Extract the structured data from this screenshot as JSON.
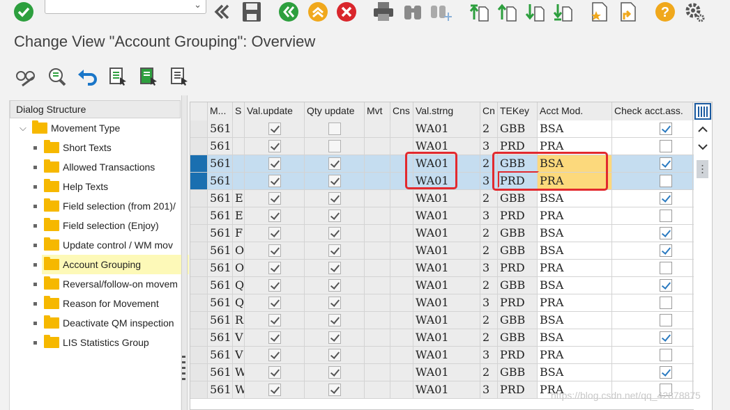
{
  "toolbar": {
    "command_field_value": "",
    "icons": [
      "enter-icon",
      "back-icon",
      "save-icon",
      "back-green-icon",
      "exit-icon",
      "cancel-icon",
      "print-icon",
      "find-icon",
      "find-next-icon",
      "first-page-icon",
      "previous-page-icon",
      "next-page-icon",
      "last-page-icon",
      "create-session-icon",
      "shortcut-icon",
      "help-icon",
      "settings-icon"
    ]
  },
  "title": "Change View \"Account Grouping\": Overview",
  "app_toolbar_icons": [
    "display-change-icon",
    "details-icon",
    "undo-icon",
    "select-all-icon",
    "select-block-icon",
    "deselect-all-icon"
  ],
  "dialog_structure": {
    "header": "Dialog Structure",
    "root": "Movement Type",
    "items": [
      "Short Texts",
      "Allowed Transactions",
      "Help Texts",
      "Field selection (from 201)/",
      "Field selection (Enjoy)",
      "Update control / WM mov",
      "Account Grouping",
      "Reversal/follow-on movem",
      "Reason for Movement",
      "Deactivate QM inspection",
      "LIS Statistics Group"
    ],
    "selected_index": 6
  },
  "table": {
    "columns": [
      "M...",
      "S",
      "Val.update",
      "Qty update",
      "Mvt",
      "Cns",
      "Val.strng",
      "Cn",
      "TEKey",
      "Acct Mod.",
      "Check acct.ass."
    ],
    "rows": [
      {
        "m": "561",
        "s": "",
        "val_update": true,
        "qty_update": false,
        "mvt": "",
        "cns": "",
        "val_strng": "WA01",
        "cn": "2",
        "tekey": "GBB",
        "acct_mod": "BSA",
        "check": true,
        "selected": false
      },
      {
        "m": "561",
        "s": "",
        "val_update": true,
        "qty_update": false,
        "mvt": "",
        "cns": "",
        "val_strng": "WA01",
        "cn": "3",
        "tekey": "PRD",
        "acct_mod": "PRA",
        "check": false,
        "selected": false
      },
      {
        "m": "561",
        "s": "",
        "val_update": true,
        "qty_update": true,
        "mvt": "",
        "cns": "",
        "val_strng": "WA01",
        "cn": "2",
        "tekey": "GBB",
        "acct_mod": "BSA",
        "check": true,
        "selected": true
      },
      {
        "m": "561",
        "s": "",
        "val_update": true,
        "qty_update": true,
        "mvt": "",
        "cns": "",
        "val_strng": "WA01",
        "cn": "3",
        "tekey": "PRD",
        "acct_mod": "PRA",
        "check": false,
        "selected": true
      },
      {
        "m": "561",
        "s": "E",
        "val_update": true,
        "qty_update": true,
        "mvt": "",
        "cns": "",
        "val_strng": "WA01",
        "cn": "2",
        "tekey": "GBB",
        "acct_mod": "BSA",
        "check": true,
        "selected": false
      },
      {
        "m": "561",
        "s": "E",
        "val_update": true,
        "qty_update": true,
        "mvt": "",
        "cns": "",
        "val_strng": "WA01",
        "cn": "3",
        "tekey": "PRD",
        "acct_mod": "PRA",
        "check": false,
        "selected": false
      },
      {
        "m": "561",
        "s": "F",
        "val_update": true,
        "qty_update": true,
        "mvt": "",
        "cns": "",
        "val_strng": "WA01",
        "cn": "2",
        "tekey": "GBB",
        "acct_mod": "BSA",
        "check": true,
        "selected": false
      },
      {
        "m": "561",
        "s": "O",
        "val_update": true,
        "qty_update": true,
        "mvt": "",
        "cns": "",
        "val_strng": "WA01",
        "cn": "2",
        "tekey": "GBB",
        "acct_mod": "BSA",
        "check": true,
        "selected": false
      },
      {
        "m": "561",
        "s": "O",
        "val_update": true,
        "qty_update": true,
        "mvt": "",
        "cns": "",
        "val_strng": "WA01",
        "cn": "3",
        "tekey": "PRD",
        "acct_mod": "PRA",
        "check": false,
        "selected": false
      },
      {
        "m": "561",
        "s": "Q",
        "val_update": true,
        "qty_update": true,
        "mvt": "",
        "cns": "",
        "val_strng": "WA01",
        "cn": "2",
        "tekey": "GBB",
        "acct_mod": "BSA",
        "check": true,
        "selected": false
      },
      {
        "m": "561",
        "s": "Q",
        "val_update": true,
        "qty_update": true,
        "mvt": "",
        "cns": "",
        "val_strng": "WA01",
        "cn": "3",
        "tekey": "PRD",
        "acct_mod": "PRA",
        "check": false,
        "selected": false
      },
      {
        "m": "561",
        "s": "R",
        "val_update": true,
        "qty_update": true,
        "mvt": "",
        "cns": "",
        "val_strng": "WA01",
        "cn": "2",
        "tekey": "GBB",
        "acct_mod": "BSA",
        "check": false,
        "selected": false
      },
      {
        "m": "561",
        "s": "V",
        "val_update": true,
        "qty_update": true,
        "mvt": "",
        "cns": "",
        "val_strng": "WA01",
        "cn": "2",
        "tekey": "GBB",
        "acct_mod": "BSA",
        "check": true,
        "selected": false
      },
      {
        "m": "561",
        "s": "V",
        "val_update": true,
        "qty_update": true,
        "mvt": "",
        "cns": "",
        "val_strng": "WA01",
        "cn": "3",
        "tekey": "PRD",
        "acct_mod": "PRA",
        "check": false,
        "selected": false
      },
      {
        "m": "561",
        "s": "W",
        "val_update": true,
        "qty_update": true,
        "mvt": "",
        "cns": "",
        "val_strng": "WA01",
        "cn": "2",
        "tekey": "GBB",
        "acct_mod": "BSA",
        "check": true,
        "selected": false
      },
      {
        "m": "561",
        "s": "W",
        "val_update": true,
        "qty_update": true,
        "mvt": "",
        "cns": "",
        "val_strng": "WA01",
        "cn": "3",
        "tekey": "PRD",
        "acct_mod": "PRA",
        "check": false,
        "selected": false
      }
    ]
  },
  "watermark": "https://blog.csdn.net/qq_42878875",
  "colors": {
    "selected_row": "#c5ddf0",
    "acct_mod_highlight": "#fcd97c",
    "annotation": "#e2292e"
  }
}
